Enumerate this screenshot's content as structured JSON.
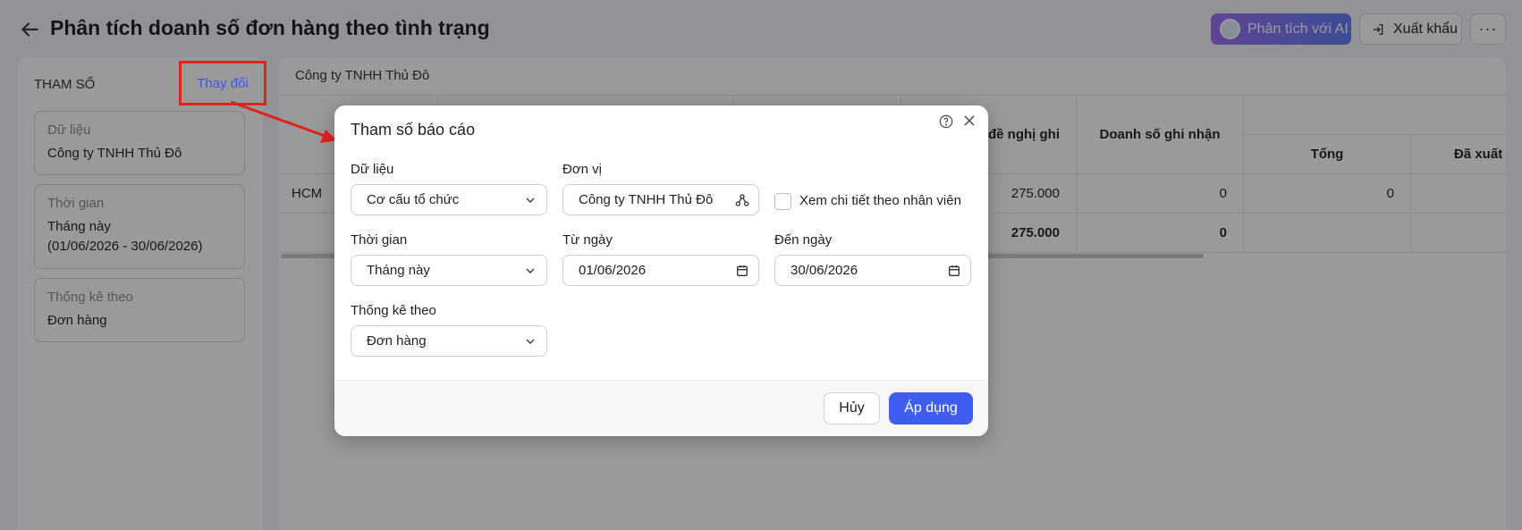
{
  "header": {
    "title": "Phân tích doanh số đơn hàng theo tình trạng",
    "ai_button": "Phân tích với AI",
    "export_button": "Xuất khẩu",
    "more_button": "···"
  },
  "params": {
    "title": "THAM SỐ",
    "change_link": "Thay đổi",
    "cards": [
      {
        "label": "Dữ liệu",
        "value": "Công ty TNHH Thủ Đô",
        "value2": ""
      },
      {
        "label": "Thời gian",
        "value": "Tháng này",
        "value2": "(01/06/2026 - 30/06/2026)"
      },
      {
        "label": "Thống kê theo",
        "value": "Đơn hàng",
        "value2": ""
      }
    ]
  },
  "report": {
    "company": "Công ty TNHH Thủ Đô",
    "headers": {
      "de_nghi_ghi": "đề nghị ghi",
      "doanh_so_ghi_nhan": "Doanh số ghi nhận",
      "tong": "Tổng",
      "da_xuat_hoa": "Đã xuất hó"
    },
    "rows": [
      {
        "name": "HCM",
        "de_nghi_ghi": "275.000",
        "doanh_so_ghi_nhan": "0",
        "tong": "0"
      },
      {
        "name": "",
        "de_nghi_ghi": "275.000",
        "doanh_so_ghi_nhan": "0",
        "tong": ""
      }
    ]
  },
  "dialog": {
    "title": "Tham số báo cáo",
    "data_label": "Dữ liệu",
    "data_value": "Cơ cấu tổ chức",
    "unit_label": "Đơn vị",
    "unit_value": "Công ty TNHH Thủ Đô",
    "detail_checkbox_label": "Xem chi tiết theo nhân viên",
    "time_label": "Thời gian",
    "time_value": "Tháng này",
    "from_label": "Từ ngày",
    "from_value": "01/06/2026",
    "to_label": "Đến ngày",
    "to_value": "30/06/2026",
    "stat_label": "Thống kê theo",
    "stat_value": "Đơn hàng",
    "cancel_button": "Hủy",
    "apply_button": "Áp dụng"
  },
  "colors": {
    "accent": "#3f5ef0",
    "highlight": "#e3221b",
    "ai_gradient_start": "#9b6cf3",
    "ai_gradient_end": "#5e7af5"
  }
}
